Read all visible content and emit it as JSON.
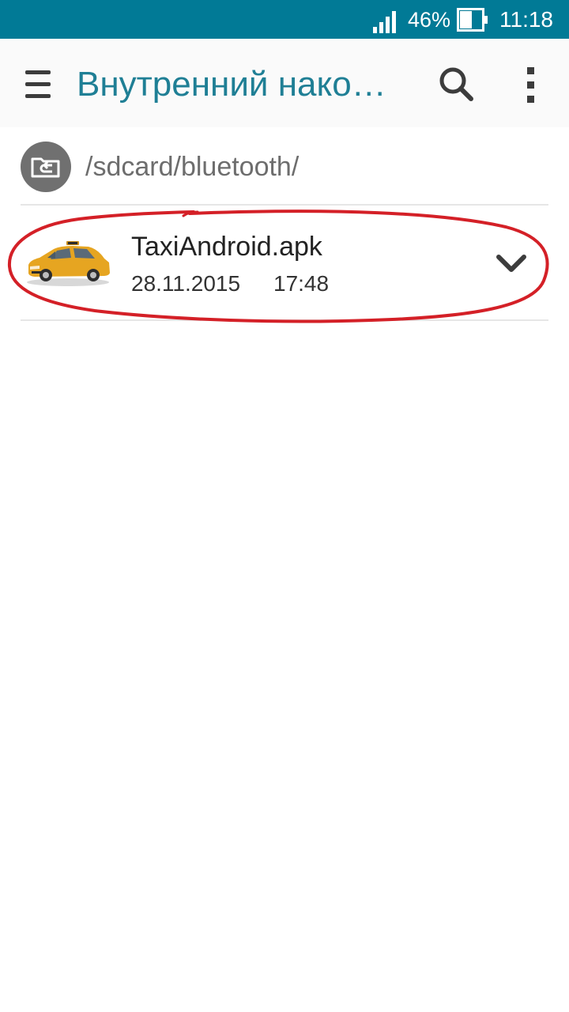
{
  "status_bar": {
    "battery_percent": "46%",
    "time": "11:18",
    "background_color": "#017a96",
    "icons": [
      "signal-icon",
      "battery-icon"
    ]
  },
  "app_bar": {
    "title": "Внутренний нако…",
    "title_color": "#1f7f95",
    "icons": [
      "menu-icon",
      "search-icon",
      "more-vert-icon"
    ]
  },
  "path_bar": {
    "path": "/sdcard/bluetooth/",
    "icon": "folder-up-icon"
  },
  "files": [
    {
      "name": "TaxiAndroid.apk",
      "date": "28.11.2015",
      "time": "17:48",
      "thumbnail": "taxi-car-thumbnail",
      "action_icon": "chevron-down-icon"
    }
  ],
  "annotation": {
    "color": "#d42027",
    "shape": "hand-drawn-ellipse"
  }
}
